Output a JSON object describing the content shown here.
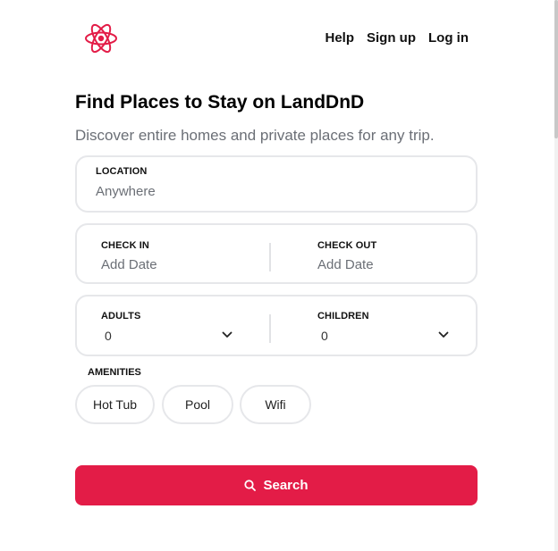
{
  "brand": {
    "accent_color": "#e31c47",
    "logo_icon": "react-atom-icon"
  },
  "nav": {
    "help": "Help",
    "signup": "Sign up",
    "login": "Log in"
  },
  "hero": {
    "title": "Find Places to Stay on LandDnD",
    "subtitle": "Discover entire homes and private places for any trip."
  },
  "location": {
    "label": "LOCATION",
    "placeholder": "Anywhere"
  },
  "dates": {
    "checkin_label": "CHECK IN",
    "checkin_placeholder": "Add Date",
    "checkout_label": "CHECK OUT",
    "checkout_placeholder": "Add Date"
  },
  "guests": {
    "adults_label": "ADULTS",
    "adults_value": "0",
    "children_label": "CHILDREN",
    "children_value": "0"
  },
  "amenities": {
    "label": "AMENITIES",
    "items": [
      {
        "label": "Hot Tub"
      },
      {
        "label": "Pool"
      },
      {
        "label": "Wifi"
      }
    ]
  },
  "search": {
    "label": "Search",
    "icon": "search-icon"
  }
}
